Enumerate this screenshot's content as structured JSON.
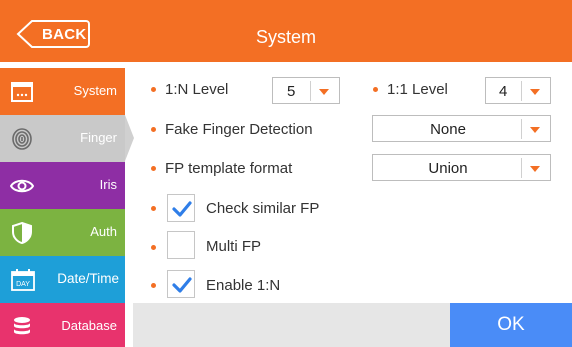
{
  "header": {
    "back_label": "BACK",
    "title": "System"
  },
  "sidebar": {
    "items": [
      {
        "label": "System",
        "color": "#f36f24",
        "icon": "window-icon"
      },
      {
        "label": "Finger",
        "color": "#c9c9c9",
        "icon": "fingerprint-icon",
        "selected": true
      },
      {
        "label": "Iris",
        "color": "#8e2ea4",
        "icon": "eye-icon"
      },
      {
        "label": "Auth",
        "color": "#7cb341",
        "icon": "shield-icon"
      },
      {
        "label": "Date/Time",
        "color": "#1e9fd8",
        "icon": "calendar-icon",
        "icon_text": "DAY"
      },
      {
        "label": "Database",
        "color": "#e8336d",
        "icon": "database-icon"
      }
    ]
  },
  "settings": {
    "n_level": {
      "label": "1:N Level",
      "value": "5"
    },
    "one_level": {
      "label": "1:1 Level",
      "value": "4"
    },
    "fake_finger": {
      "label": "Fake Finger Detection",
      "value": "None"
    },
    "fp_template": {
      "label": "FP template format",
      "value": "Union"
    },
    "check_similar": {
      "label": "Check similar FP",
      "checked": true
    },
    "multi_fp": {
      "label": "Multi FP",
      "checked": false
    },
    "enable_1n": {
      "label": "Enable 1:N",
      "checked": true
    }
  },
  "footer": {
    "ok_label": "OK"
  },
  "colors": {
    "accent": "#f36f24",
    "ok_button": "#4a8cf7",
    "checkmark": "#2f7ee8"
  }
}
